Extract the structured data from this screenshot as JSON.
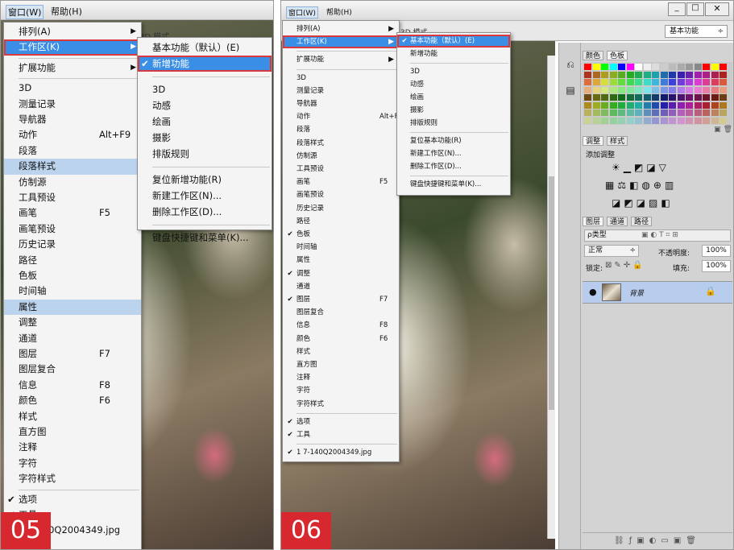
{
  "left": {
    "menubar": {
      "window": "窗口(W)",
      "help": "帮助(H)"
    },
    "toolbar_text": "3D 模式",
    "step": "05",
    "main_menu": [
      {
        "label": "排列(A)",
        "sub": true
      },
      {
        "label": "工作区(K)",
        "sub": true,
        "state": "sel"
      },
      {
        "sep": true
      },
      {
        "label": "扩展功能",
        "sub": true
      },
      {
        "sep": true
      },
      {
        "label": "3D"
      },
      {
        "label": "测量记录"
      },
      {
        "label": "导航器"
      },
      {
        "label": "动作",
        "shortcut": "Alt+F9"
      },
      {
        "label": "段落"
      },
      {
        "label": "段落样式",
        "state": "hl"
      },
      {
        "label": "仿制源"
      },
      {
        "label": "工具预设"
      },
      {
        "label": "画笔",
        "shortcut": "F5"
      },
      {
        "label": "画笔预设"
      },
      {
        "label": "历史记录"
      },
      {
        "label": "路径"
      },
      {
        "label": "色板"
      },
      {
        "label": "时间轴"
      },
      {
        "label": "属性",
        "state": "hl"
      },
      {
        "label": "调整"
      },
      {
        "label": "通道"
      },
      {
        "label": "图层",
        "shortcut": "F7"
      },
      {
        "label": "图层复合"
      },
      {
        "label": "信息",
        "shortcut": "F8"
      },
      {
        "label": "颜色",
        "shortcut": "F6"
      },
      {
        "label": "样式"
      },
      {
        "label": "直方图"
      },
      {
        "label": "注释"
      },
      {
        "label": "字符"
      },
      {
        "label": "字符样式"
      },
      {
        "sep": true
      },
      {
        "label": "选项",
        "check": true
      },
      {
        "label": "工具",
        "check": true
      },
      {
        "label": "1 7-140Q2004349.jpg"
      }
    ],
    "sub_menu": [
      {
        "label": "基本功能（默认）(E)"
      },
      {
        "label": "新增功能",
        "check": true,
        "state": "sel"
      },
      {
        "sep": true
      },
      {
        "label": "3D"
      },
      {
        "label": "动感"
      },
      {
        "label": "绘画"
      },
      {
        "label": "摄影"
      },
      {
        "label": "排版规则"
      },
      {
        "sep": true
      },
      {
        "label": "复位新增功能(R)"
      },
      {
        "label": "新建工作区(N)..."
      },
      {
        "label": "删除工作区(D)..."
      },
      {
        "sep": true
      },
      {
        "label": "键盘快捷键和菜单(K)..."
      }
    ]
  },
  "right": {
    "menubar": {
      "window": "窗口(W)",
      "help": "帮助(H)"
    },
    "toolbar_text": "3D 模式",
    "workspace": "基本功能",
    "step": "06",
    "main_menu": [
      {
        "label": "排列(A)",
        "sub": true
      },
      {
        "label": "工作区(K)",
        "sub": true,
        "state": "sel"
      },
      {
        "sep": true
      },
      {
        "label": "扩展功能",
        "sub": true
      },
      {
        "sep": true
      },
      {
        "label": "3D"
      },
      {
        "label": "测量记录"
      },
      {
        "label": "导航器"
      },
      {
        "label": "动作",
        "shortcut": "Alt+F9"
      },
      {
        "label": "段落"
      },
      {
        "label": "段落样式"
      },
      {
        "label": "仿制源"
      },
      {
        "label": "工具预设"
      },
      {
        "label": "画笔",
        "shortcut": "F5"
      },
      {
        "label": "画笔预设"
      },
      {
        "label": "历史记录"
      },
      {
        "label": "路径"
      },
      {
        "label": "色板",
        "check": true
      },
      {
        "label": "时间轴"
      },
      {
        "label": "属性"
      },
      {
        "label": "调整",
        "check": true
      },
      {
        "label": "通道"
      },
      {
        "label": "图层",
        "check": true,
        "shortcut": "F7"
      },
      {
        "label": "图层复合"
      },
      {
        "label": "信息",
        "shortcut": "F8"
      },
      {
        "label": "颜色",
        "shortcut": "F6"
      },
      {
        "label": "样式"
      },
      {
        "label": "直方图"
      },
      {
        "label": "注释"
      },
      {
        "label": "字符"
      },
      {
        "label": "字符样式"
      },
      {
        "sep": true
      },
      {
        "label": "选项",
        "check": true
      },
      {
        "label": "工具",
        "check": true
      },
      {
        "sep": true
      },
      {
        "label": "1 7-140Q2004349.jpg",
        "check": true
      }
    ],
    "sub_menu": [
      {
        "label": "基本功能（默认）(E)",
        "check": true,
        "state": "sel"
      },
      {
        "label": "新增功能"
      },
      {
        "sep": true
      },
      {
        "label": "3D"
      },
      {
        "label": "动感"
      },
      {
        "label": "绘画"
      },
      {
        "label": "摄影"
      },
      {
        "label": "排版规则"
      },
      {
        "sep": true
      },
      {
        "label": "复位基本功能(R)"
      },
      {
        "label": "新建工作区(N)..."
      },
      {
        "label": "删除工作区(D)..."
      },
      {
        "sep": true
      },
      {
        "label": "键盘快捷键和菜单(K)..."
      }
    ],
    "swatch_tabs": [
      "颜色",
      "色板"
    ],
    "adjust_tabs": [
      "调整",
      "样式"
    ],
    "adjust_title": "添加调整",
    "layer_tabs": [
      "图层",
      "通道",
      "路径"
    ],
    "layer_filter": "ρ类型",
    "blend_mode": "正常",
    "opacity_label": "不透明度:",
    "opacity": "100%",
    "lock_label": "锁定:",
    "fill_label": "填充:",
    "fill": "100%",
    "layer_name": "背景",
    "colors": {
      "accent": "#3a8ee6",
      "highlight": "#bcd3ee",
      "step": "#d7282f",
      "outline": "#d9383d"
    }
  }
}
